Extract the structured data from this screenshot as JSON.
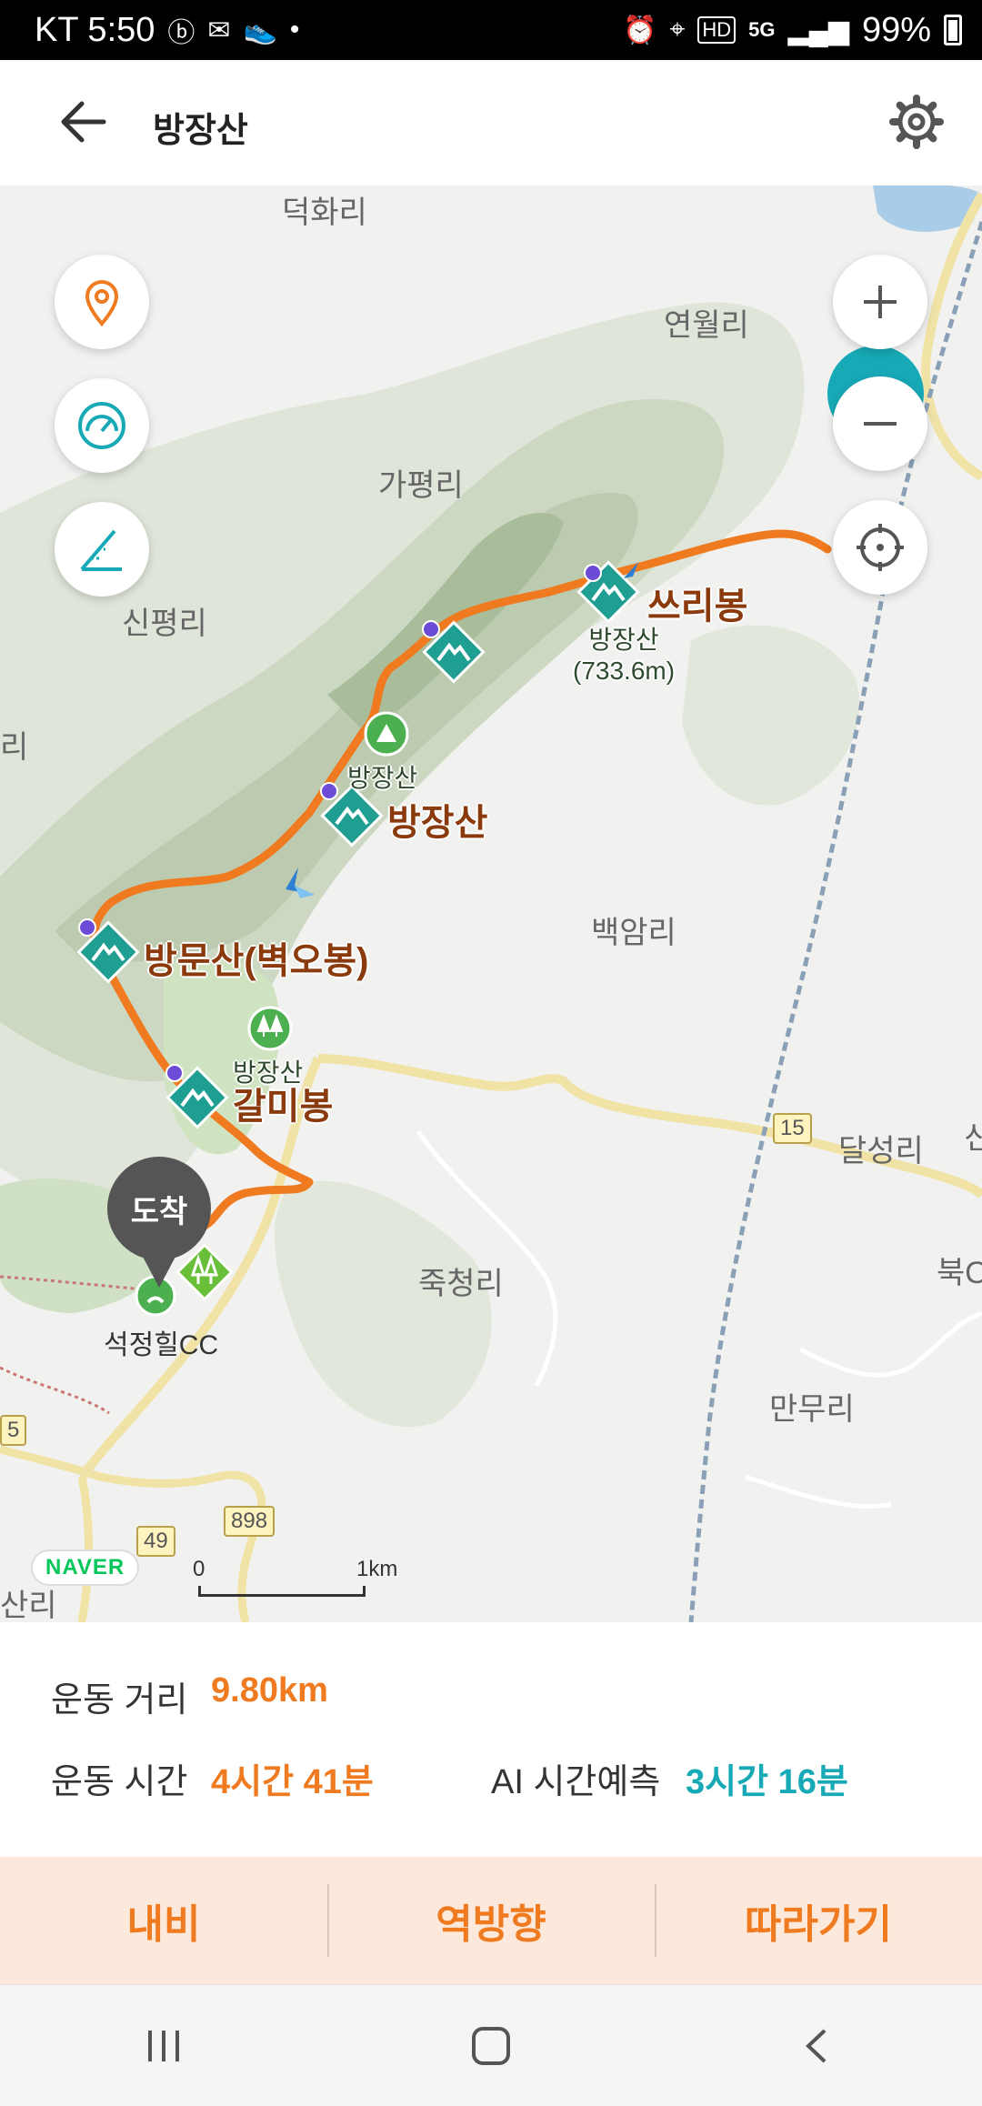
{
  "status_bar": {
    "carrier_time": "KT 5:50",
    "battery": "99%",
    "network": "5G",
    "hd": "HD"
  },
  "header": {
    "title": "방장산",
    "back_icon": "arrow-left-icon",
    "settings_icon": "gear-icon"
  },
  "map": {
    "places": {
      "p1": "덕화리",
      "p2": "연월리",
      "p3": "가평리",
      "p4": "신평리",
      "p5": "리",
      "p6": "백암리",
      "p7": "달성리",
      "p8": "신",
      "p9": "죽청리",
      "p10": "북O",
      "p11": "만무리",
      "p12": "산리",
      "p13": "석정힐CC"
    },
    "peaks": {
      "k1": "쓰리봉",
      "k2": "방장산",
      "k3": "방문산(벽오봉)",
      "k4": "갈미봉"
    },
    "small_labels": {
      "s1": "방장산",
      "s1b": "(733.6m)",
      "s2": "방장산",
      "s3": "방장산"
    },
    "roads": {
      "r1": "15",
      "r2": "49",
      "r3": "898",
      "r4": "5"
    },
    "arrive_label": "도착",
    "naver_logo": "NAVER",
    "scale_start": "0",
    "scale_end": "1km",
    "route_color": "#ef7a1f"
  },
  "stats": {
    "distance_label": "운동 거리",
    "distance_value": "9.80km",
    "time_label": "운동 시간",
    "time_value": "4시간 41분",
    "ai_label": "AI 시간예측",
    "ai_value": "3시간 16분"
  },
  "actions": {
    "navigate": "내비",
    "reverse": "역방향",
    "follow": "따라가기"
  },
  "colors": {
    "accent": "#ef7a1f",
    "teal": "#17a9b6",
    "peak_marker": "#1f9e92"
  }
}
